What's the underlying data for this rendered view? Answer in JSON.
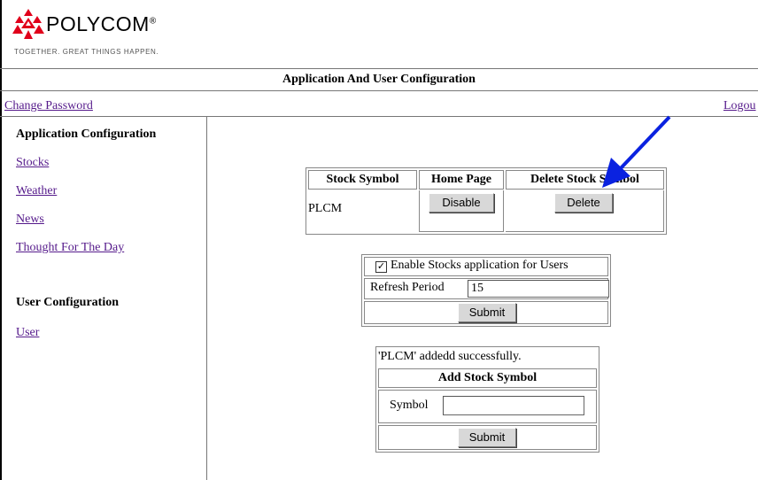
{
  "brand": {
    "name": "POLYCOM",
    "trademark": "®",
    "tagline": "TOGETHER. GREAT THINGS HAPPEN."
  },
  "page_title": "Application And User Configuration",
  "top_links": {
    "change_password": "Change Password",
    "logout": "Logou"
  },
  "sidebar": {
    "app_config_heading": "Application Configuration",
    "app_items": [
      "Stocks",
      "Weather",
      "News",
      "Thought For The Day"
    ],
    "user_config_heading": "User Configuration",
    "user_items": [
      "User"
    ]
  },
  "stock_table": {
    "headers": [
      "Stock Symbol",
      "Home Page",
      "Delete Stock Symbol"
    ],
    "rows": [
      {
        "symbol": "PLCM",
        "home_button": "Disable",
        "delete_button": "Delete"
      }
    ]
  },
  "settings": {
    "enable_label": "Enable Stocks application for Users",
    "enable_checked": true,
    "refresh_label": "Refresh Period",
    "refresh_value": "15",
    "submit_label": "Submit"
  },
  "add_form": {
    "status_message": "'PLCM' addedd successfully.",
    "heading": "Add Stock Symbol",
    "symbol_label": "Symbol",
    "symbol_value": "",
    "submit_label": "Submit"
  },
  "colors": {
    "link": "#551a8b",
    "arrow": "#0a22e0",
    "logo": "#e0001b"
  }
}
